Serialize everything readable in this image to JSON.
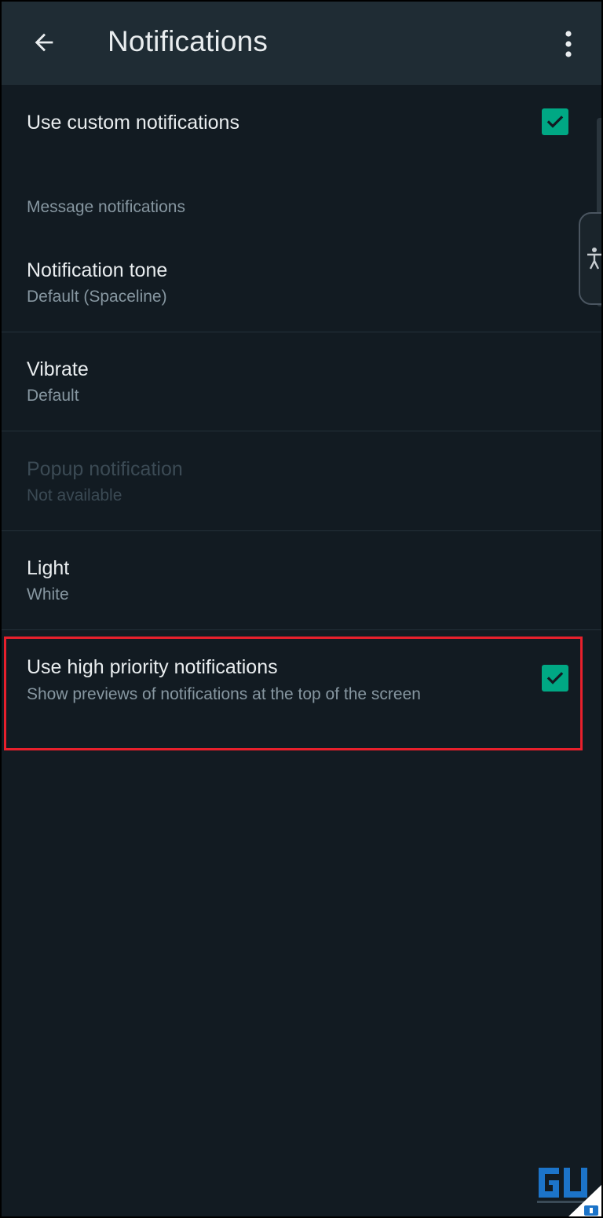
{
  "header": {
    "title": "Notifications",
    "back_icon": "arrow-left-icon",
    "menu_icon": "more-vertical-icon"
  },
  "settings": {
    "custom": {
      "label": "Use custom notifications",
      "checked": true
    },
    "section_header": "Message notifications",
    "tone": {
      "label": "Notification tone",
      "value": "Default (Spaceline)"
    },
    "vibrate": {
      "label": "Vibrate",
      "value": "Default"
    },
    "popup": {
      "label": "Popup notification",
      "value": "Not available",
      "enabled": false
    },
    "light": {
      "label": "Light",
      "value": "White"
    },
    "high_priority": {
      "label": "Use high priority notifications",
      "description": "Show previews of notifications at the top of the screen",
      "checked": true
    }
  },
  "watermark": {
    "logo_icon": "gadgets-to-use-logo-icon"
  },
  "colors": {
    "background": "#121b22",
    "appbar": "#1f2c34",
    "accent": "#00a884",
    "highlight_box": "#e8202c"
  }
}
